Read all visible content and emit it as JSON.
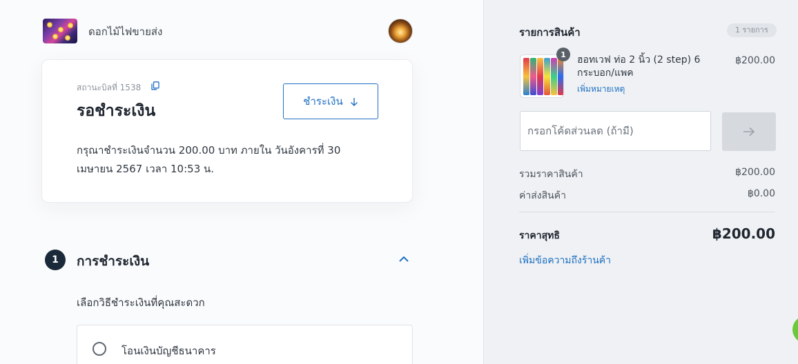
{
  "header": {
    "store_name": "ดอกไม้ไฟขายส่ง",
    "logo_icon": "store-logo",
    "avatar_icon": "user-avatar"
  },
  "status_card": {
    "order_number": "สถานะบิลที่ 1538",
    "status": "รอชำระเงิน",
    "pay_button_label": "ชำระเงิน",
    "pay_button_icon": "arrow-down-icon",
    "description": "กรุณาชำระเงินจำนวน 200.00 บาท ภายใน วันอังคารที่ 30 เมษายน 2567 เวลา 10:53 น."
  },
  "payment_section": {
    "step_number": "1",
    "title": "การชำระเงิน",
    "prompt": "เลือกวิธีชำระเงินที่คุณสะดวก",
    "methods": [
      {
        "label": "โอนเงินบัญชีธนาคาร",
        "selected": false
      }
    ]
  },
  "summary": {
    "title": "รายการสินค้า",
    "item_count": "1 รายการ",
    "items": [
      {
        "name": "ฮอทเวฟ ท่อ 2 นิ้ว (2 step) 6 กระบอก/แพค",
        "add_note": "เพิ่มหมายเหตุ",
        "price": "฿200.00",
        "quantity": "1"
      }
    ],
    "discount_placeholder": "กรอกโค้ดส่วนลด (ถ้ามี)",
    "discount_value": "",
    "subtotal_label": "รวมราคาสินค้า",
    "subtotal_value": "฿200.00",
    "shipping_label": "ค่าส่งสินค้า",
    "shipping_value": "฿0.00",
    "total_label": "ราคาสุทธิ",
    "total_value": "฿200.00",
    "store_note_link": "เพิ่มข้อความถึงร้านค้า"
  },
  "colors": {
    "accent": "#1d6fc2",
    "step_badge": "#1b2a3a",
    "summary_bg": "#eff1f4",
    "chat": "#6cc93a"
  }
}
